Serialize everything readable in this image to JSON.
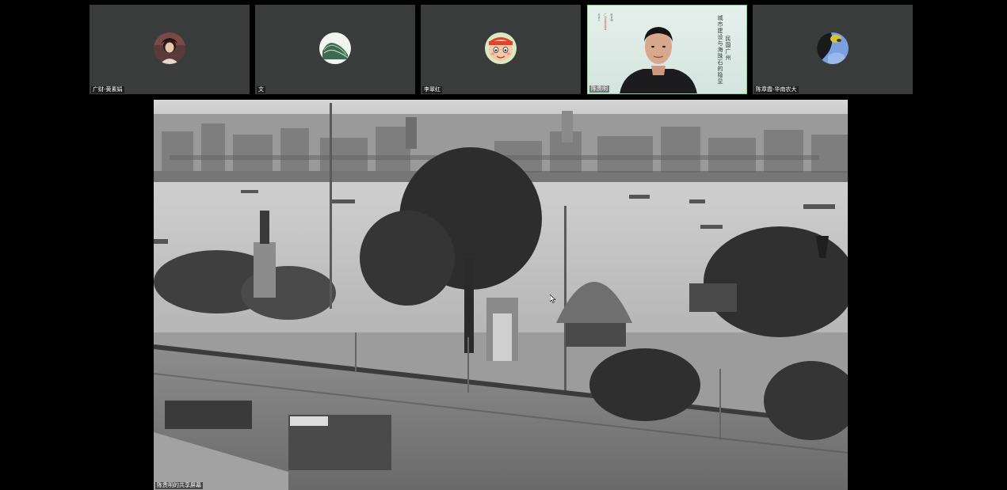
{
  "participants": [
    {
      "name": "广财-黄素娟",
      "avatar": "woman-portrait-icon"
    },
    {
      "name": "文",
      "avatar": "green-landscape-icon"
    },
    {
      "name": "李翠红",
      "avatar": "cartoon-character-icon"
    },
    {
      "name": "陈贵明",
      "avatar": "speaker-video"
    },
    {
      "name": "陈章霞-华南农大",
      "avatar": "blue-cartoon-icon"
    }
  ],
  "speaker_slide": {
    "title": "城市建设与海珠石的隐显",
    "subtitle": "民国广州",
    "col_red": "广州市城市建设",
    "col_a": "主讲人",
    "col_b": "陈贵明"
  },
  "share": {
    "label": "陈贵明的共享屏幕"
  },
  "colors": {
    "tile_bg": "#3a3c3b",
    "active_speaker_border": "#7fd88c",
    "background": "#000000"
  }
}
